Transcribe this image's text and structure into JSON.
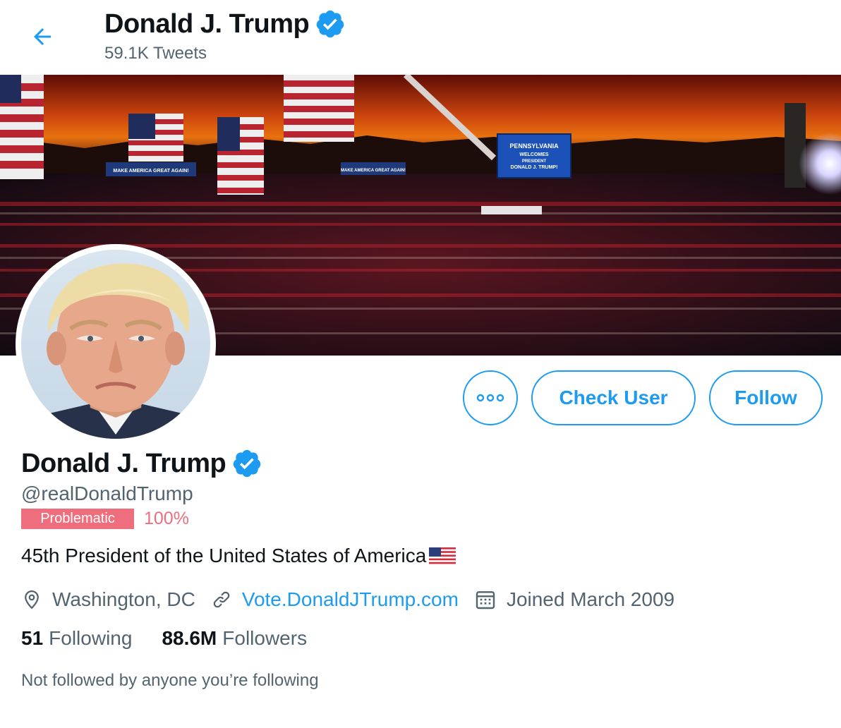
{
  "header": {
    "name": "Donald J. Trump",
    "tweet_count": "59.1K Tweets"
  },
  "banner": {
    "left_sign": "MAKE AMERICA GREAT AGAIN!",
    "right_sign": "MAKE AMERICA GREAT AGAIN!",
    "screen_line1": "PENNSYLVANIA",
    "screen_line2": "WELCOMES",
    "screen_line3": "PRESIDENT",
    "screen_line4": "DONALD J. TRUMP!"
  },
  "actions": {
    "more_label": "•••",
    "check_user_label": "Check User",
    "follow_label": "Follow"
  },
  "profile": {
    "name": "Donald J. Trump",
    "handle": "@realDonaldTrump",
    "badge_label": "Problematic",
    "badge_percent": "100%",
    "bio": "45th President of the United States of America",
    "location": "Washington, DC",
    "website": "Vote.DonaldJTrump.com",
    "joined": "Joined March 2009",
    "following_count": "51",
    "following_label": "Following",
    "followers_count": "88.6M",
    "followers_label": "Followers",
    "not_followed": "Not followed by anyone you’re following"
  },
  "colors": {
    "accent": "#1d9bf0",
    "badge": "#ee6e7d",
    "muted": "#536471"
  },
  "icons": {
    "back": "arrow-left-icon",
    "verified": "verified-badge-icon",
    "location": "location-pin-icon",
    "link": "link-icon",
    "calendar": "calendar-icon"
  }
}
